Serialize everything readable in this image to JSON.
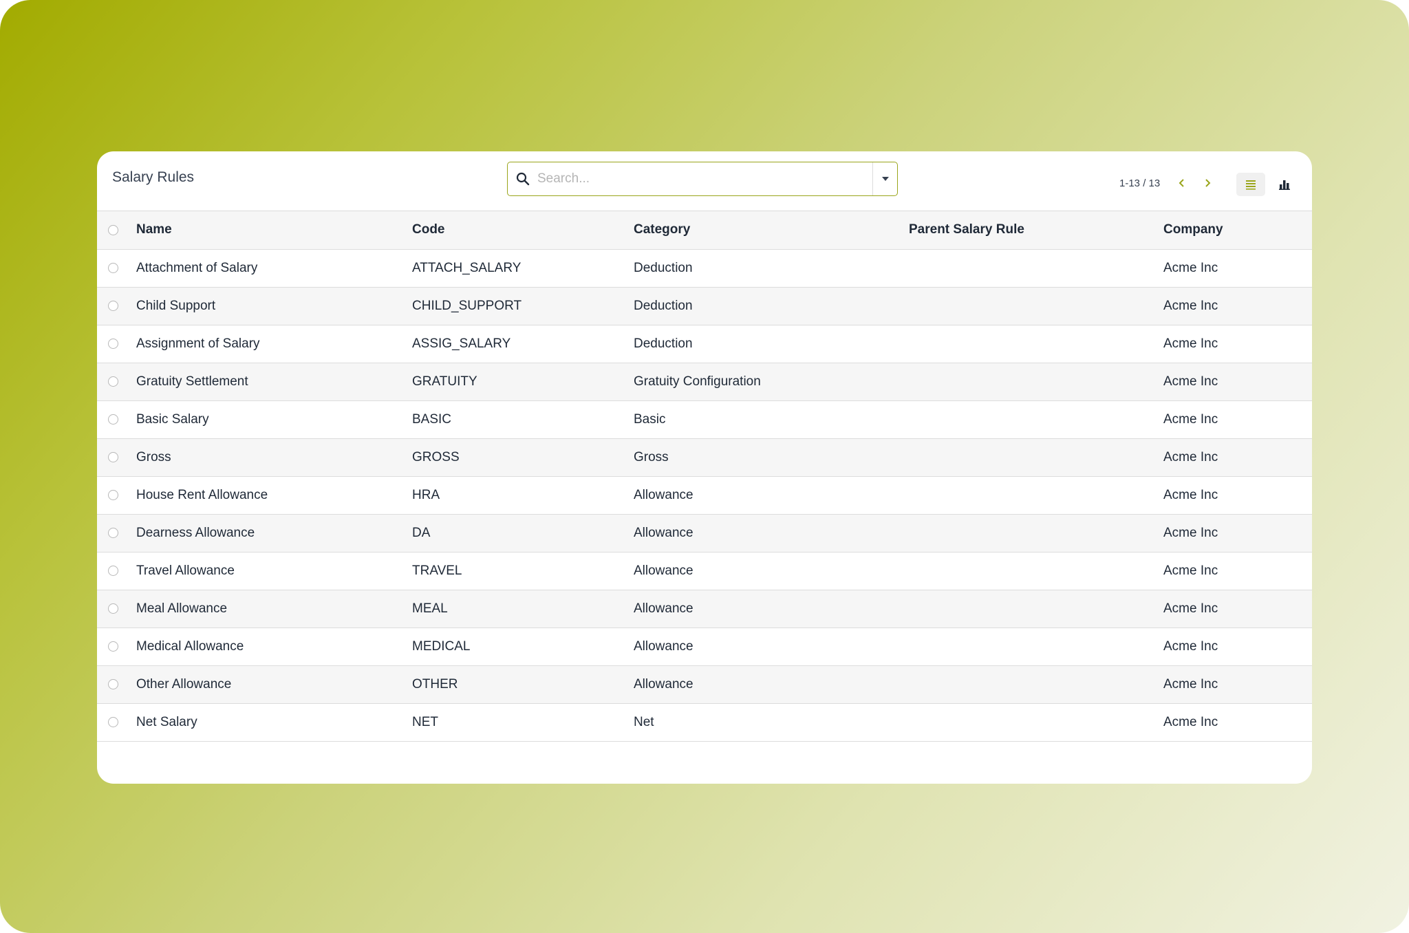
{
  "header": {
    "title": "Salary Rules",
    "search_placeholder": "Search...",
    "search_value": "",
    "pager": "1-13 / 13"
  },
  "colors": {
    "accent": "#9aa51a",
    "text": "#1f2937",
    "row_alt": "#f6f6f6"
  },
  "icons": {
    "search": "search-icon",
    "dropdown": "caret-down-icon",
    "prev": "chevron-left-icon",
    "next": "chevron-right-icon",
    "list_view": "list-view-icon",
    "graph_view": "bar-chart-icon"
  },
  "table": {
    "columns": [
      "Name",
      "Code",
      "Category",
      "Parent Salary Rule",
      "Company"
    ],
    "rows": [
      {
        "name": "Attachment of Salary",
        "code": "ATTACH_SALARY",
        "category": "Deduction",
        "parent": "",
        "company": "Acme Inc"
      },
      {
        "name": "Child Support",
        "code": "CHILD_SUPPORT",
        "category": "Deduction",
        "parent": "",
        "company": "Acme Inc"
      },
      {
        "name": "Assignment of Salary",
        "code": "ASSIG_SALARY",
        "category": "Deduction",
        "parent": "",
        "company": "Acme Inc"
      },
      {
        "name": "Gratuity Settlement",
        "code": "GRATUITY",
        "category": "Gratuity Configuration",
        "parent": "",
        "company": "Acme Inc"
      },
      {
        "name": "Basic Salary",
        "code": "BASIC",
        "category": "Basic",
        "parent": "",
        "company": "Acme Inc"
      },
      {
        "name": "Gross",
        "code": "GROSS",
        "category": "Gross",
        "parent": "",
        "company": "Acme Inc"
      },
      {
        "name": "House Rent Allowance",
        "code": "HRA",
        "category": "Allowance",
        "parent": "",
        "company": "Acme Inc"
      },
      {
        "name": "Dearness Allowance",
        "code": "DA",
        "category": "Allowance",
        "parent": "",
        "company": "Acme Inc"
      },
      {
        "name": "Travel Allowance",
        "code": "TRAVEL",
        "category": "Allowance",
        "parent": "",
        "company": "Acme Inc"
      },
      {
        "name": "Meal Allowance",
        "code": "MEAL",
        "category": "Allowance",
        "parent": "",
        "company": "Acme Inc"
      },
      {
        "name": "Medical Allowance",
        "code": "MEDICAL",
        "category": "Allowance",
        "parent": "",
        "company": "Acme Inc"
      },
      {
        "name": "Other Allowance",
        "code": "OTHER",
        "category": "Allowance",
        "parent": "",
        "company": "Acme Inc"
      },
      {
        "name": "Net Salary",
        "code": "NET",
        "category": "Net",
        "parent": "",
        "company": "Acme Inc"
      }
    ]
  }
}
